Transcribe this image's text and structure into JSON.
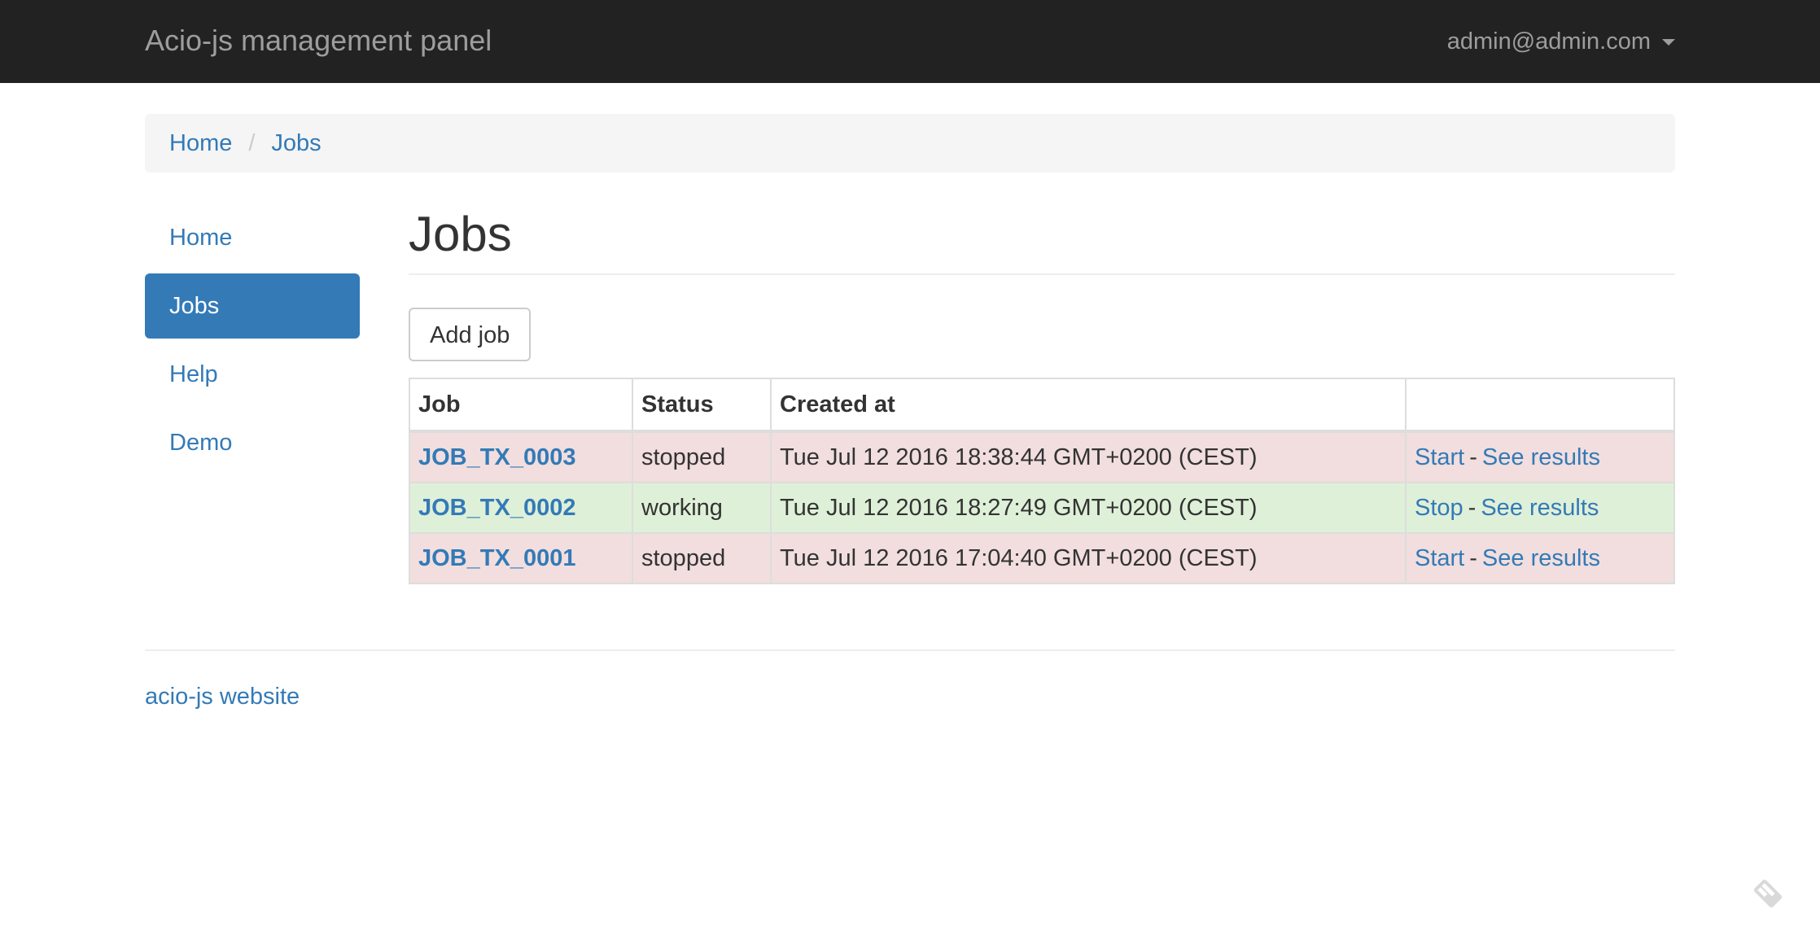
{
  "navbar": {
    "brand": "Acio-js management panel",
    "user": "admin@admin.com"
  },
  "breadcrumb": {
    "items": [
      "Home",
      "Jobs"
    ],
    "separator": "/"
  },
  "sidebar": {
    "items": [
      {
        "label": "Home",
        "active": false
      },
      {
        "label": "Jobs",
        "active": true
      },
      {
        "label": "Help",
        "active": false
      },
      {
        "label": "Demo",
        "active": false
      }
    ]
  },
  "main": {
    "title": "Jobs",
    "add_button": "Add job",
    "table": {
      "headers": [
        "Job",
        "Status",
        "Created at",
        ""
      ],
      "rows": [
        {
          "job": "JOB_TX_0003",
          "status": "stopped",
          "created_at": "Tue Jul 12 2016 18:38:44 GMT+0200 (CEST)",
          "action": "Start",
          "separator": "-",
          "results": "See results"
        },
        {
          "job": "JOB_TX_0002",
          "status": "working",
          "created_at": "Tue Jul 12 2016 18:27:49 GMT+0200 (CEST)",
          "action": "Stop",
          "separator": "-",
          "results": "See results"
        },
        {
          "job": "JOB_TX_0001",
          "status": "stopped",
          "created_at": "Tue Jul 12 2016 17:04:40 GMT+0200 (CEST)",
          "action": "Start",
          "separator": "-",
          "results": "See results"
        }
      ]
    }
  },
  "footer": {
    "link": "acio-js website"
  },
  "colors": {
    "navbar_bg": "#222222",
    "link": "#337ab7",
    "active_bg": "#337ab7",
    "row_stopped": "#f2dede",
    "row_working": "#dff0d8",
    "breadcrumb_bg": "#f5f5f5"
  },
  "icons": {
    "user_menu": "caret-down-icon",
    "corner": "feedback-pencil-icon"
  }
}
